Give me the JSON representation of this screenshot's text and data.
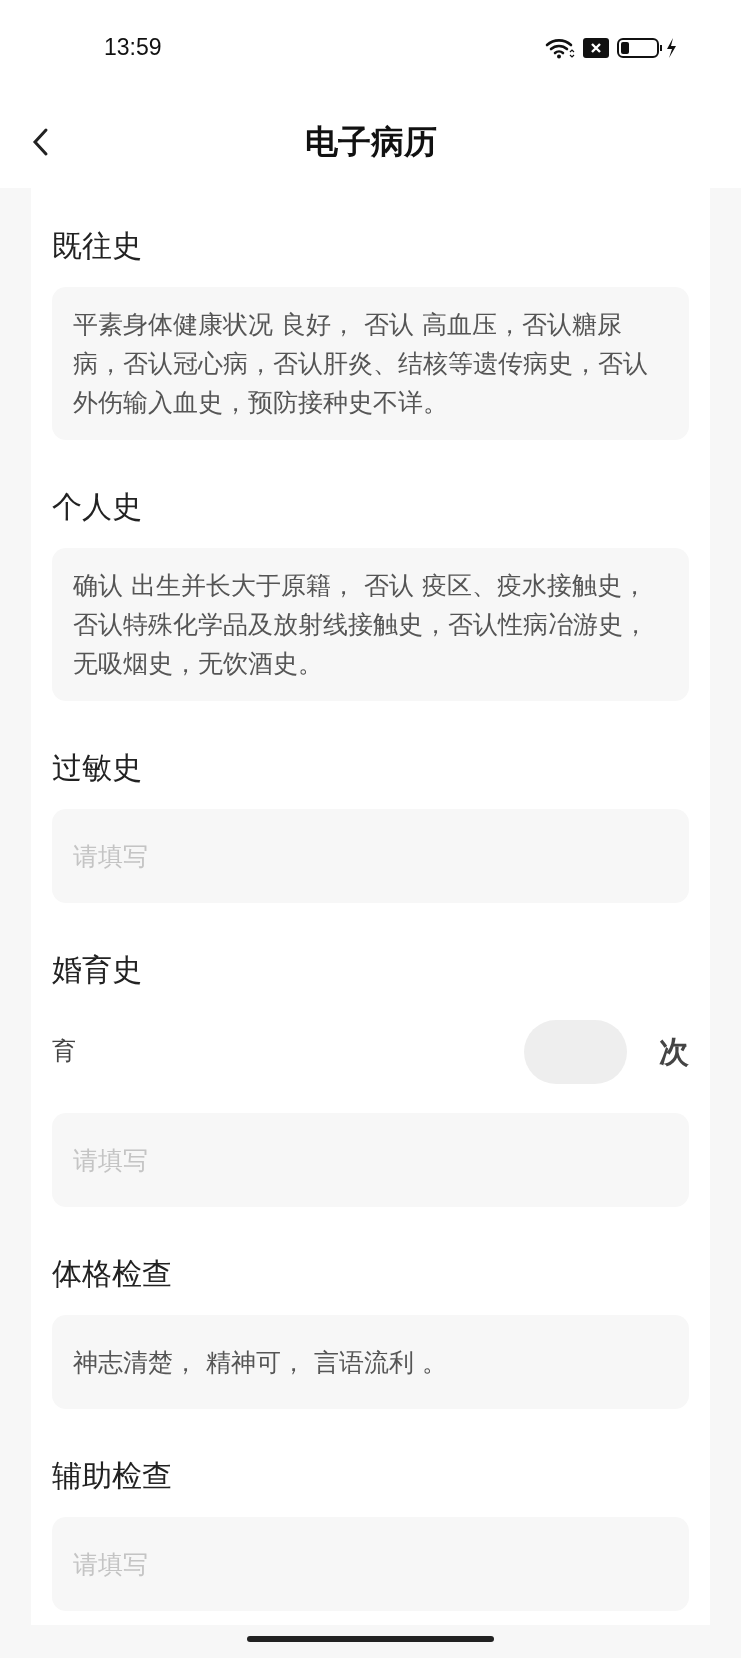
{
  "status_bar": {
    "time": "13:59"
  },
  "header": {
    "title": "电子病历"
  },
  "sections": [
    {
      "kind": "text",
      "label": "既往史",
      "value": "平素身体健康状况 良好， 否认 高血压，否认糖尿病，否认冠心病，否认肝炎、结核等遗传病史，否认外伤输入血史，预防接种史不详。"
    },
    {
      "kind": "text",
      "label": "个人史",
      "value": "确认 出生并长大于原籍， 否认 疫区、疫水接触史，否认特殊化学品及放射线接触史，否认性病冶游史，无吸烟史，无饮酒史。"
    },
    {
      "kind": "text",
      "label": "过敏史",
      "placeholder": "请填写"
    },
    {
      "kind": "count",
      "label": "婚育史",
      "count_label": "育",
      "unit": "次",
      "placeholder": "请填写"
    },
    {
      "kind": "text",
      "label": "体格检查",
      "value": "神志清楚， 精神可， 言语流利 。"
    },
    {
      "kind": "text",
      "label": "辅助检查",
      "placeholder": "请填写"
    }
  ]
}
